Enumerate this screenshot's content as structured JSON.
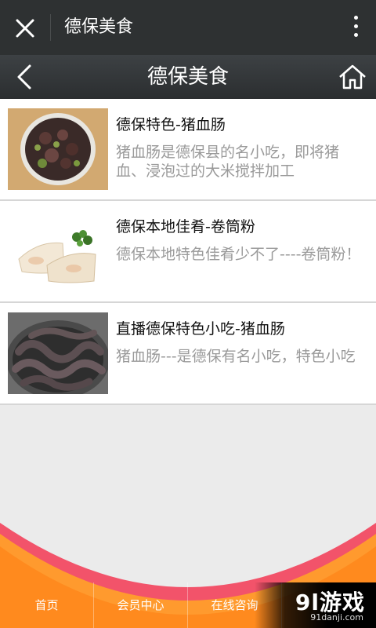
{
  "wechat_bar": {
    "title": "德保美食",
    "close_icon": "close-icon",
    "more_icon": "more-vertical-icon"
  },
  "header": {
    "title": "德保美食",
    "back_icon": "chevron-left-icon",
    "home_icon": "home-icon"
  },
  "list": {
    "items": [
      {
        "title": "德保特色-猪血肠",
        "desc": "猪血肠是德保县的名小吃，即将猪血、浸泡过的大米搅拌加工",
        "image": "pig-blood-sausage-in-bowl"
      },
      {
        "title": "德保本地佳肴-卷筒粉",
        "desc": "德保本地特色佳肴少不了----卷筒粉！",
        "image": "rice-noodle-rolls"
      },
      {
        "title": "直播德保特色小吃-猪血肠",
        "desc": "猪血肠---是德保有名小吃，特色小吃",
        "image": "sausages-in-pot"
      }
    ]
  },
  "footer": {
    "nav": [
      "首页",
      "会员中心",
      "在线咨询",
      ""
    ]
  },
  "watermark": {
    "logo": "9l游戏",
    "url": "91danji.com"
  },
  "colors": {
    "top_bar": "#2e3132",
    "footer_orange": "#ff8a1e",
    "wave_pink": "#f2536a",
    "desc_gray": "#9a9a9a"
  }
}
